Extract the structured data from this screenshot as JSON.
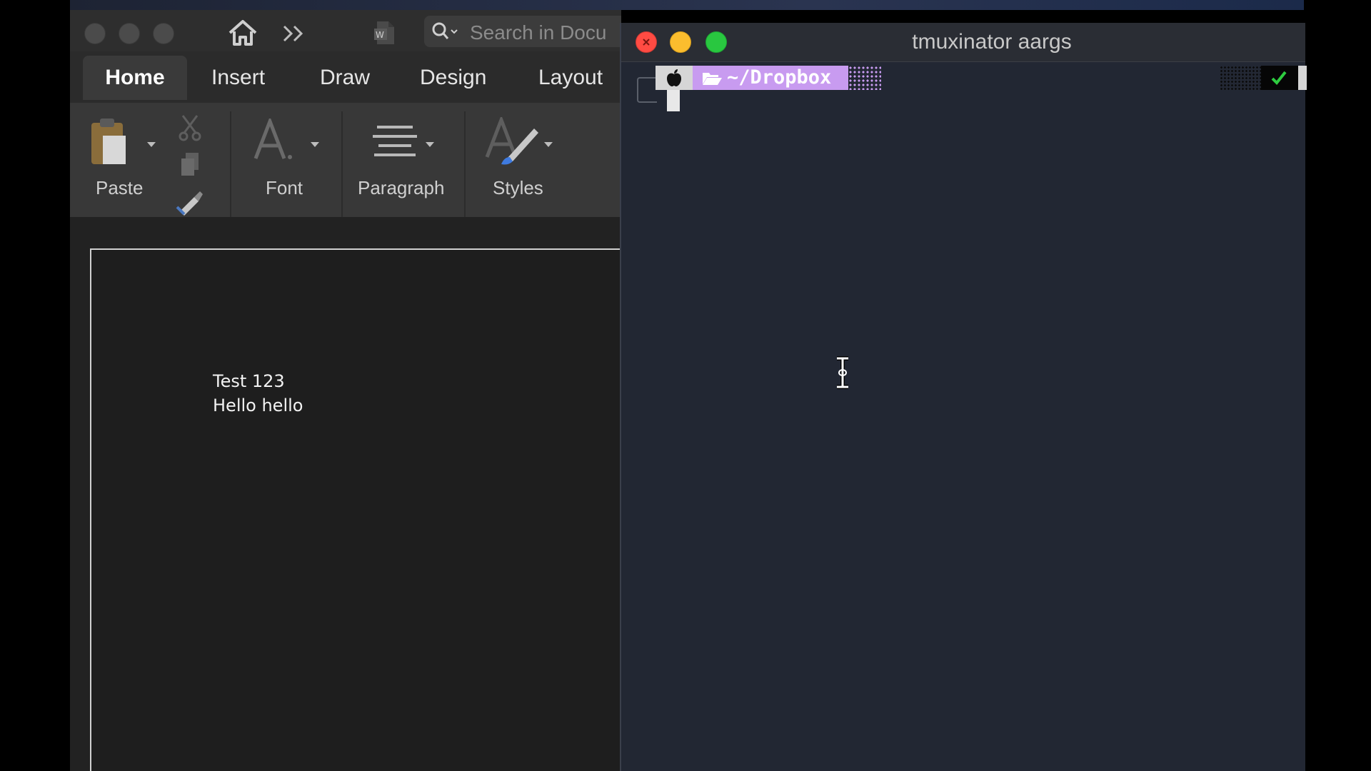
{
  "word": {
    "search_placeholder": "Search in Docu",
    "tabs": [
      {
        "label": "Home",
        "active": true
      },
      {
        "label": "Insert"
      },
      {
        "label": "Draw"
      },
      {
        "label": "Design"
      },
      {
        "label": "Layout"
      }
    ],
    "ribbon": {
      "paste_label": "Paste",
      "font_label": "Font",
      "paragraph_label": "Paragraph",
      "styles_label": "Styles"
    },
    "document": {
      "lines": [
        "Test 123",
        "Hello hello"
      ]
    }
  },
  "terminal": {
    "title": "tmuxinator aargs",
    "prompt_path": "~/Dropbox",
    "colors": {
      "background": "#222733",
      "path_segment": "#c89bf0",
      "check": "#2ecc40"
    }
  }
}
